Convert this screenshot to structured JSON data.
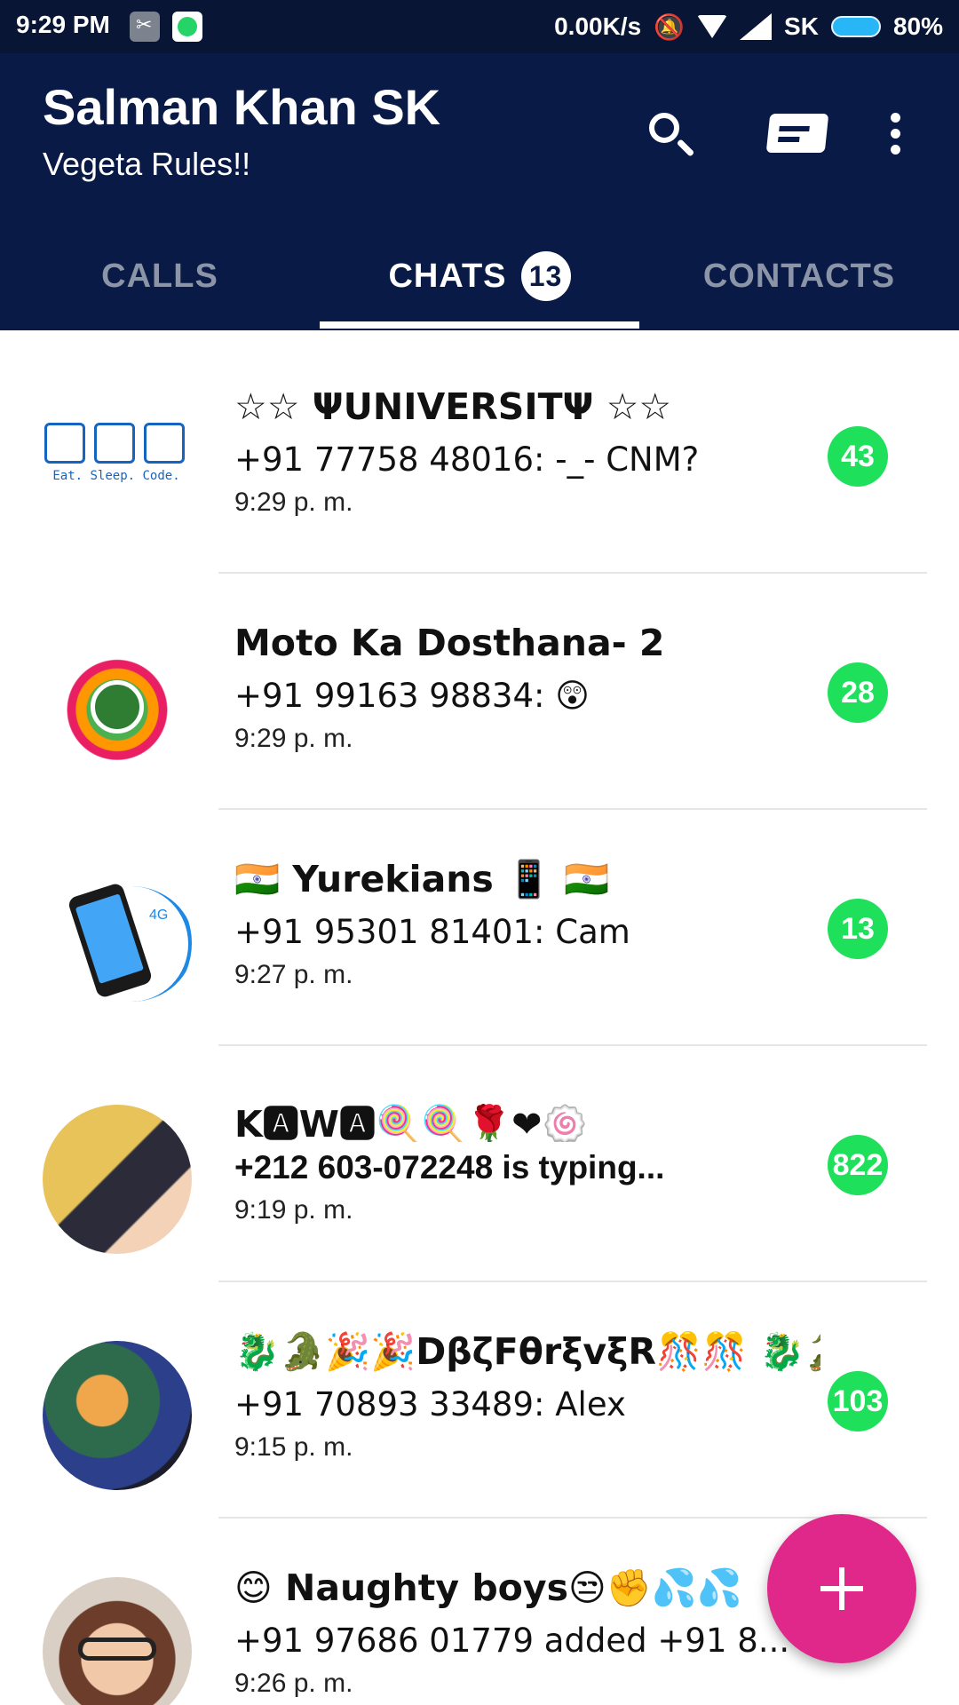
{
  "status_bar": {
    "time": "9:29 PM",
    "net_speed": "0.00K/s",
    "carrier": "SK",
    "battery": "80%",
    "icons": [
      "screenshot-icon",
      "whatsapp-icon",
      "mute-icon",
      "wifi-icon",
      "signal-icon",
      "battery-icon"
    ]
  },
  "appbar": {
    "title": "Salman Khan SK",
    "subtitle": "Vegeta Rules!!",
    "actions": [
      "search-icon",
      "new-message-icon",
      "more-options-icon"
    ]
  },
  "tabs": [
    {
      "label": "CALLS",
      "active": false
    },
    {
      "label": "CHATS",
      "active": true,
      "badge": "13"
    },
    {
      "label": "CONTACTS",
      "active": false
    }
  ],
  "chats": [
    {
      "name": "☆☆ ΨUNIVERSITΨ ☆☆",
      "preview": "+91 77758 48016: -_- CNM?",
      "time": "9:29 p. m.",
      "unread": "43",
      "avatar_text": "Eat. Sleep. Code."
    },
    {
      "name": "Moto Ka Dosthana- 2",
      "preview": "+91 99163 98834: 😲",
      "time": "9:29 p. m.",
      "unread": "28"
    },
    {
      "name": "🇮🇳 Yurekians 📱 🇮🇳",
      "preview": "+91 95301 81401: Cam",
      "time": "9:27 p. m.",
      "unread": "13",
      "avatar_text": "4G"
    },
    {
      "name": "K🅰W🅰🍭🍭🌹❤🍥",
      "preview": "+212 603-072248 is typing...",
      "time": "9:19 p. m.",
      "unread": "822"
    },
    {
      "name": "🐉🐊🎉🎉DβζFθrξvξR🎊🎊 🐉🐊",
      "preview": "+91 70893 33489: Alex",
      "time": "9:15 p. m.",
      "unread": "103"
    },
    {
      "name": "😊 Naughty boys😒✊💦💦",
      "preview": "+91 97686 01779 added +91 8...",
      "time": "9:26 p. m.",
      "unread": ""
    }
  ],
  "fab": {
    "icon": "add-icon"
  },
  "colors": {
    "status_bar": "#081534",
    "app_bar": "#081a45",
    "unread_badge": "#1ee05a",
    "fab": "#e0288a"
  }
}
